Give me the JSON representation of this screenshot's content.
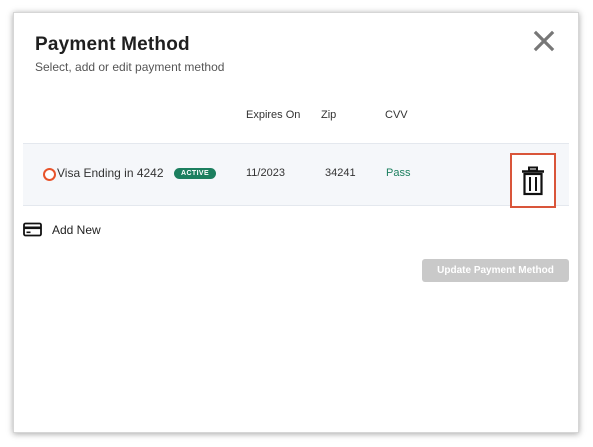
{
  "modal": {
    "title": "Payment Method",
    "subtitle": "Select, add or edit payment method"
  },
  "table": {
    "headers": {
      "expires": "Expires On",
      "zip": "Zip",
      "cvv": "CVV"
    },
    "rows": [
      {
        "card_label": "Visa Ending in 4242",
        "status": "ACTIVE",
        "expires": "11/2023",
        "zip": "34241",
        "cvv": "Pass"
      }
    ]
  },
  "actions": {
    "add_new_label": "Add New",
    "update_label": "Update Payment Method"
  },
  "icons": {
    "close": "close-icon",
    "delete": "trash-icon",
    "add": "credit-card-icon",
    "select": "radio-button"
  },
  "colors": {
    "accent_orange": "#e8542b",
    "active_green": "#1c7f5f",
    "disabled_button": "#c9c9c9",
    "row_background": "#f5f7fa"
  }
}
